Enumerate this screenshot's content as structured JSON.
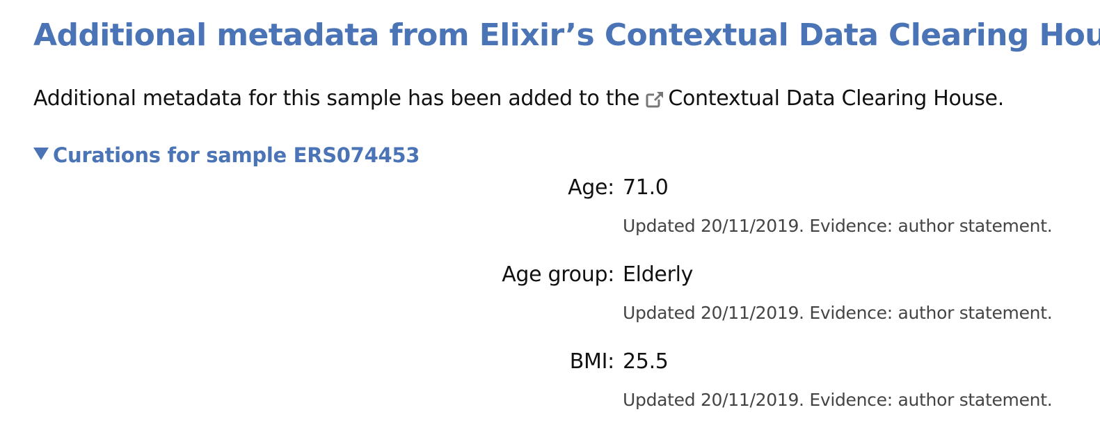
{
  "heading": "Additional metadata from Elixir’s Contextual Data Clearing House",
  "intro": {
    "text_before": "Additional metadata for this sample has been added to the",
    "link_text": "Contextual Data Clearing House",
    "text_after": ".",
    "link_icon": "external-link-icon"
  },
  "curations": {
    "toggle_label": "Curations for sample ERS074453",
    "toggle_state": "expanded",
    "items": [
      {
        "label": "Age:",
        "value": "71.0",
        "meta": "Updated 20/11/2019. Evidence: author statement."
      },
      {
        "label": "Age group:",
        "value": "Elderly",
        "meta": "Updated 20/11/2019. Evidence: author statement."
      },
      {
        "label": "BMI:",
        "value": "25.5",
        "meta": "Updated 20/11/2019. Evidence: author statement."
      }
    ]
  },
  "colors": {
    "accent": "#4a74b5",
    "text": "#111111",
    "muted_text": "#444444",
    "icon": "#777777"
  }
}
